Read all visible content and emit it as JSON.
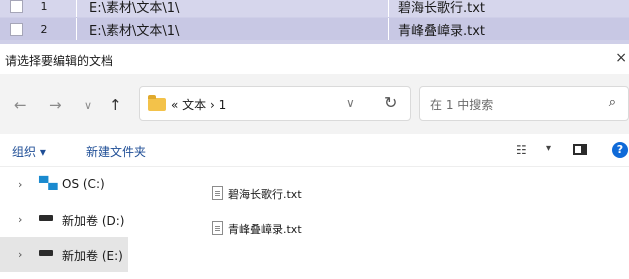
{
  "app_rows": [
    {
      "index": "1",
      "path": "E:\\素材\\文本\\1\\",
      "file": "碧海长歌行.txt"
    },
    {
      "index": "2",
      "path": "E:\\素材\\文本\\1\\",
      "file": "青峰叠嶂录.txt"
    }
  ],
  "dialog": {
    "title": "请选择要编辑的文档",
    "close": "×"
  },
  "nav_buttons": {
    "back": "←",
    "forward": "→",
    "recent": "∨",
    "up": "↑"
  },
  "address": {
    "crumb": "« 文本 › 1",
    "dropdown": "∨",
    "refresh": "↻"
  },
  "search": {
    "placeholder": "在 1 中搜索",
    "icon": "search-icon"
  },
  "toolbar": {
    "organize": "组织 ▾",
    "new_folder": "新建文件夹",
    "view_icon": "☷",
    "view_caret": "▾",
    "help": "?"
  },
  "nav_tree": [
    {
      "label": "OS (C:)",
      "icon": "windows-drive-icon",
      "selected": false
    },
    {
      "label": "新加卷 (D:)",
      "icon": "drive-icon",
      "selected": false
    },
    {
      "label": "新加卷 (E:)",
      "icon": "drive-icon",
      "selected": true
    }
  ],
  "files": [
    {
      "name": "碧海长歌行.txt"
    },
    {
      "name": "青峰叠嶂录.txt"
    }
  ],
  "colors": {
    "app_rows_bg": "#cfcfe8",
    "accent": "#0f6ad8",
    "folder": "#f3c24a"
  }
}
